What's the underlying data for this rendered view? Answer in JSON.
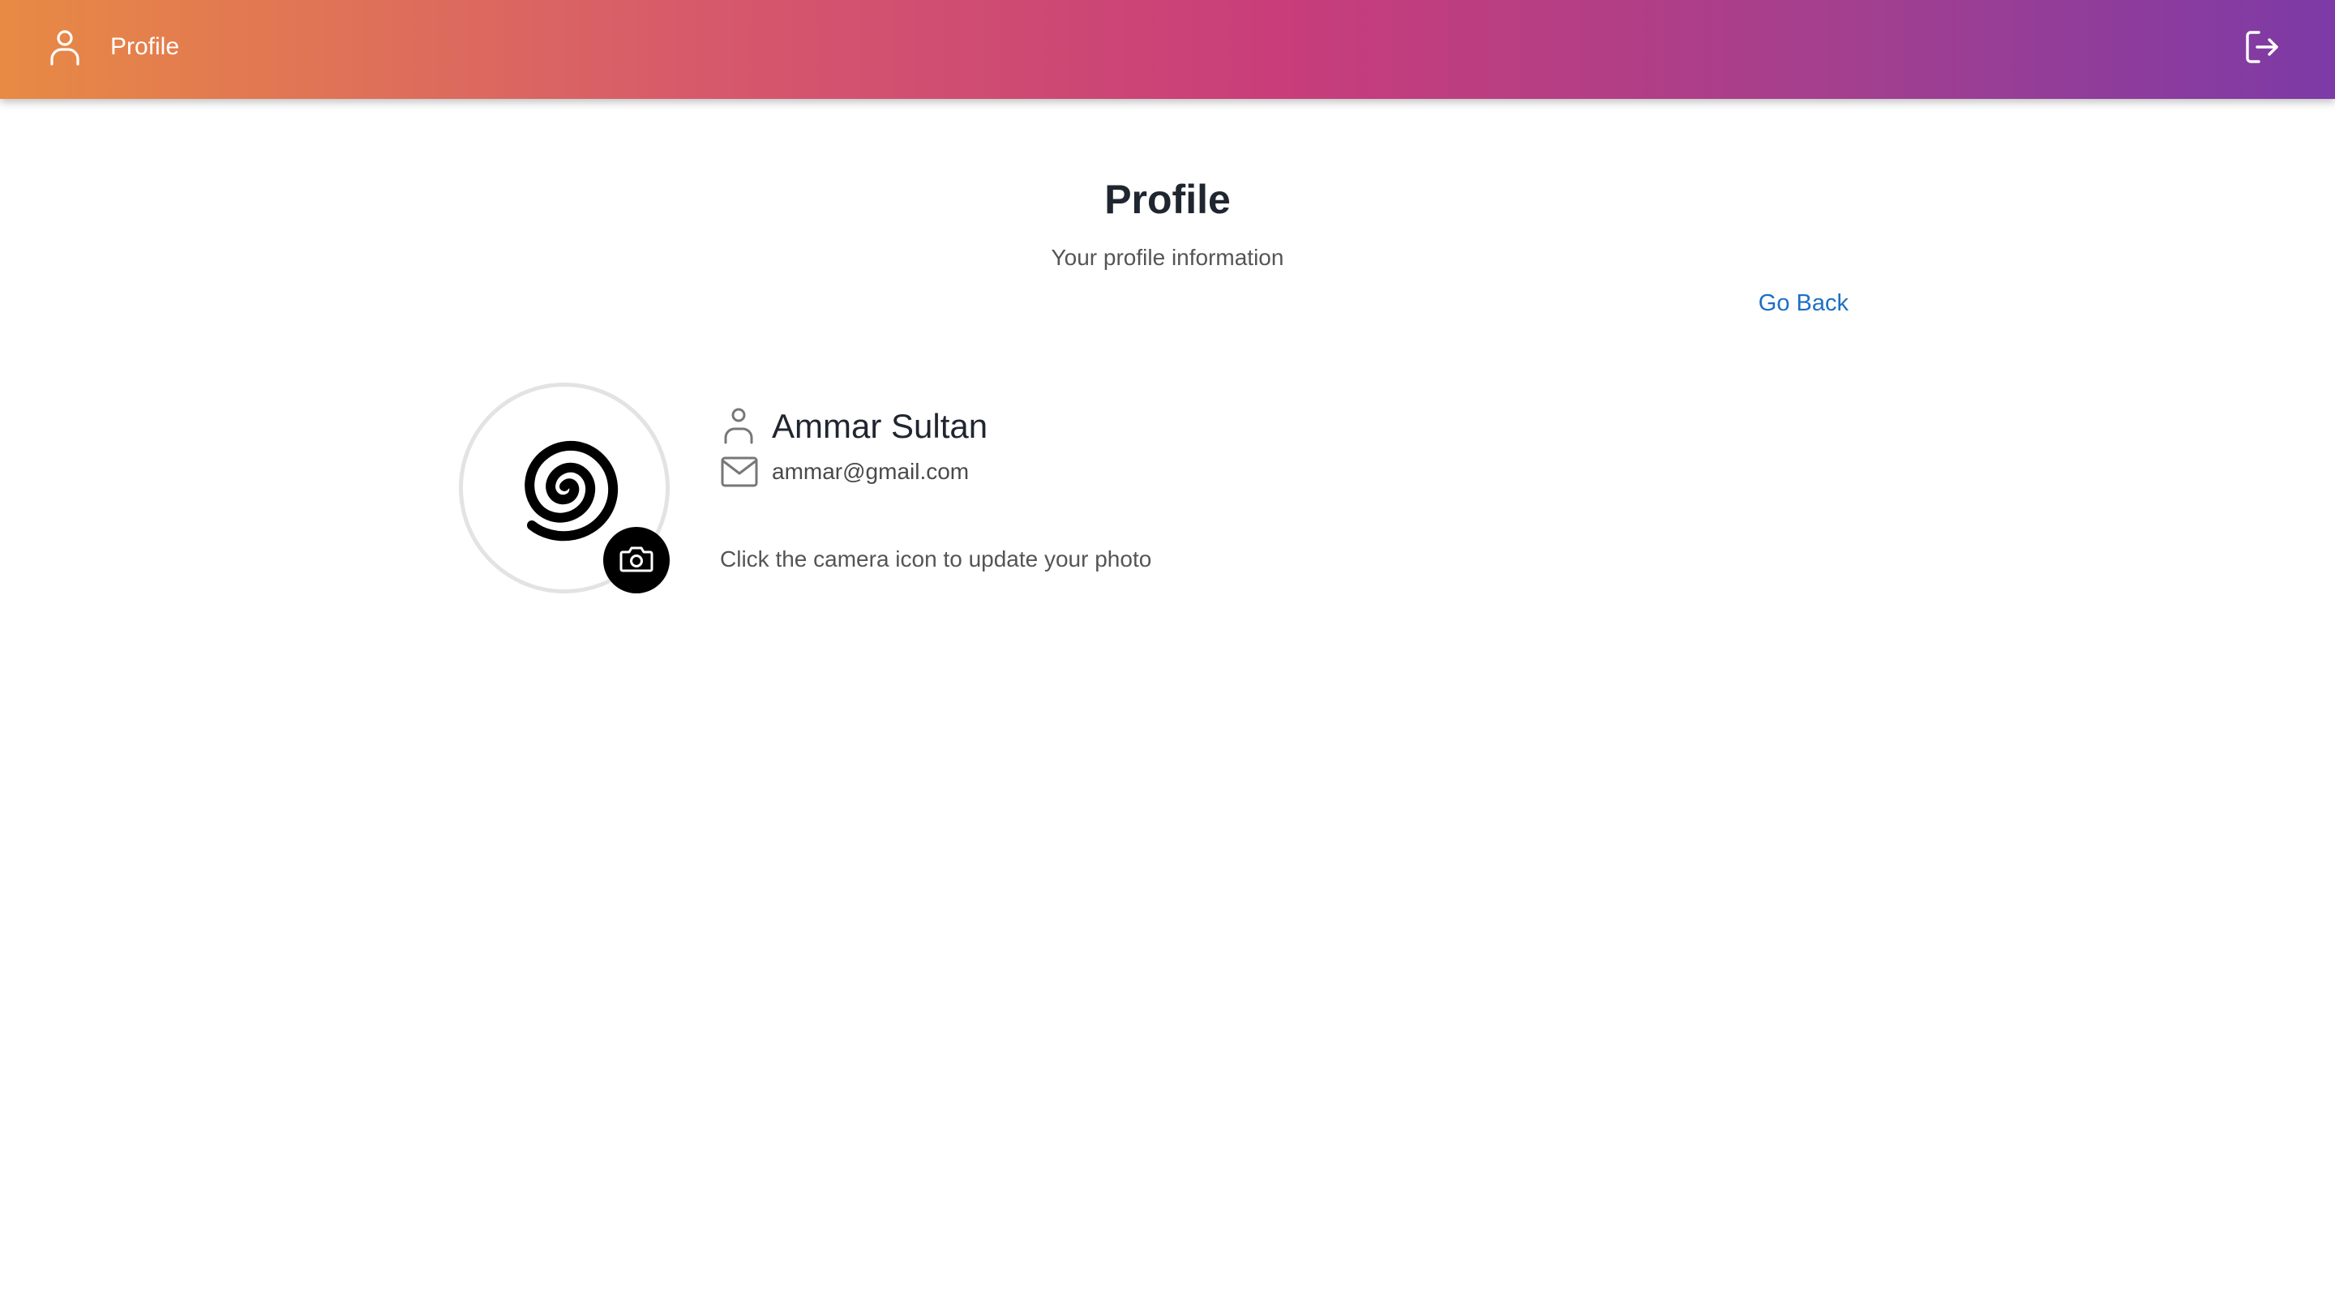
{
  "header": {
    "title": "Profile",
    "icons": {
      "user": "user-icon",
      "logout": "logout-icon"
    }
  },
  "main": {
    "title": "Profile",
    "subtitle": "Your profile information",
    "go_back": "Go Back",
    "user": {
      "name": "Ammar Sultan",
      "email": "ammar@gmail.com"
    },
    "hint": "Click the camera icon to update your photo",
    "icons": {
      "avatar": "spiral-avatar-icon",
      "camera": "camera-icon",
      "person": "person-icon",
      "mail": "mail-icon"
    }
  },
  "colors": {
    "header_gradient": [
      "#e88a44",
      "#c83d7a",
      "#7d3aa6"
    ],
    "link": "#1e6fc4",
    "text_dark": "#1f2630",
    "text_muted": "#555555"
  }
}
